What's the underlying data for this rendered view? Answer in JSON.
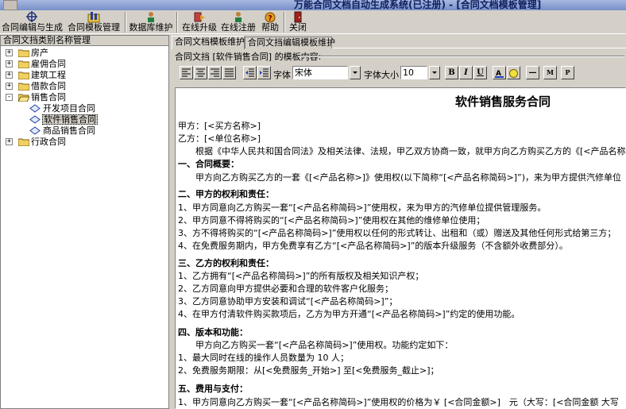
{
  "window": {
    "title": "万能合同文档自动生成系统(已注册) - [合同文档模板管理]"
  },
  "toolbar": {
    "items": [
      {
        "label": "合同编辑与生成",
        "icon": "compass-icon"
      },
      {
        "label": "合同模板管理",
        "icon": "folder-chart-icon"
      },
      {
        "label": "数据库维护",
        "icon": "user-database-icon"
      },
      {
        "label": "在线升级",
        "icon": "online-upgrade-icon"
      },
      {
        "label": "在线注册",
        "icon": "user-register-icon"
      },
      {
        "label": "帮助",
        "icon": "help-icon"
      },
      {
        "label": "关闭",
        "icon": "close-door-icon"
      }
    ]
  },
  "sidebar": {
    "header": "合同文挡类别名称管理",
    "tree": [
      {
        "label": "房产",
        "expander": "+"
      },
      {
        "label": "雇佣合同",
        "expander": "+"
      },
      {
        "label": "建筑工程",
        "expander": "+"
      },
      {
        "label": "借款合同",
        "expander": "+"
      },
      {
        "label": "销售合同",
        "expander": "-"
      },
      {
        "label": "开发项目合同"
      },
      {
        "label": "软件销售合同"
      },
      {
        "label": "商品销售合同"
      },
      {
        "label": "行政合同",
        "expander": "+"
      }
    ]
  },
  "tabs": [
    {
      "label": "合同文档模板维护"
    },
    {
      "label": "合同文挡编辑模板维护"
    }
  ],
  "editor": {
    "group_label": "合同文挡 [软件销售合同] 的模板内容:",
    "font_label": "字体",
    "font_value": "宋体",
    "size_label": "字体大小",
    "size_value": "10",
    "bold": "B",
    "italic": "I",
    "underline": "U",
    "btn_m": "M",
    "btn_p": "P",
    "btn_line": "—"
  },
  "document": {
    "title": "软件销售服务合同",
    "lines": [
      "甲方：[<买方名称>]",
      "乙方：[<单位名称>]",
      "　　根据《中华人民共和国合同法》及相关法律、法规，甲乙双方协商一致，就甲方向乙方购买乙方的《[<产品名称",
      "一、合同概要：",
      "　　甲方向乙方购买乙方的一套《[<产品名称>]》使用权(以下简称“[<产品名称简码>]”)，来为甲方提供汽修单位",
      "二、甲方的权利和责任：",
      "1、甲方同意向乙方购买一套“[<产品名称简码>]”使用权，来为甲方的汽修单位提供管理服务。",
      "2、甲方同意不得将购买的“[<产品名称简码>]”使用权在其他的维修单位使用；",
      "3、方不得将购买的“[<产品名称简码>]”使用权以任何的形式转让、出租和（或）赠送及其他任何形式给第三方；",
      "4、在免费服务期内，甲方免费享有乙方“[<产品名称简码>]”的版本升级服务（不含额外收费部分）。",
      "三、乙方的权利和责任：",
      "1、乙方拥有“[<产品名称简码>]”的所有版权及相关知识产权；",
      "2、乙方同意向甲方提供必要和合理的软件客户化服务；",
      "3、乙方同意协助甲方安装和调试“[<产品名称简码>]”；",
      "4、在甲方付清软件购买款项后，乙方为甲方开通“[<产品名称简码>]”约定的使用功能。",
      "四、版本和功能：",
      "　　甲方向乙方购买一套“[<产品名称简码>]”使用权。功能约定如下：",
      "1、最大同时在线的操作人员数量为 10 人；",
      "2、免费服务期限：从[<免费服务_开始>] 至[<免费服务_截止>]；",
      "五、费用与支付：",
      "1、甲方同意向乙方购买一套“[<产品名称简码>]”使用权的价格为￥ [<合同金额>]　元（大写：[<合同金额 大写"
    ]
  }
}
